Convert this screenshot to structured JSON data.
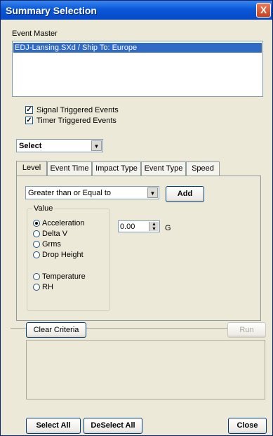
{
  "window": {
    "title": "Summary Selection",
    "close_glyph": "X"
  },
  "event_master": {
    "label": "Event Master",
    "items": [
      "EDJ-Lansing.SXd / Ship To: Europe"
    ]
  },
  "checkboxes": [
    {
      "label": "Signal Triggered Events",
      "checked": true
    },
    {
      "label": "Timer Triggered Events",
      "checked": true
    }
  ],
  "select_combo": {
    "value": "Select"
  },
  "tabs": [
    "Level",
    "Event Time",
    "Impact Type",
    "Event Type",
    "Speed"
  ],
  "level": {
    "operator": "Greater than or Equal to",
    "add_label": "Add",
    "value_group_label": "Value",
    "options": [
      "Acceleration",
      "Delta V",
      "Grms",
      "Drop Height",
      "Temperature",
      "RH"
    ],
    "selected": "Acceleration",
    "amount": "0.00",
    "unit": "G"
  },
  "criteria": {
    "clear_label": "Clear Criteria",
    "run_label": "Run"
  },
  "footer": {
    "select_all": "Select All",
    "deselect_all": "DeSelect All",
    "close": "Close"
  },
  "colors": {
    "titlebar": "#0a58d8",
    "selection": "#316ac5",
    "face": "#ece9d8"
  },
  "icons": {
    "close": "close-icon",
    "dropdown": "chevron-down-icon",
    "spinner": "spinner-arrows-icon"
  }
}
